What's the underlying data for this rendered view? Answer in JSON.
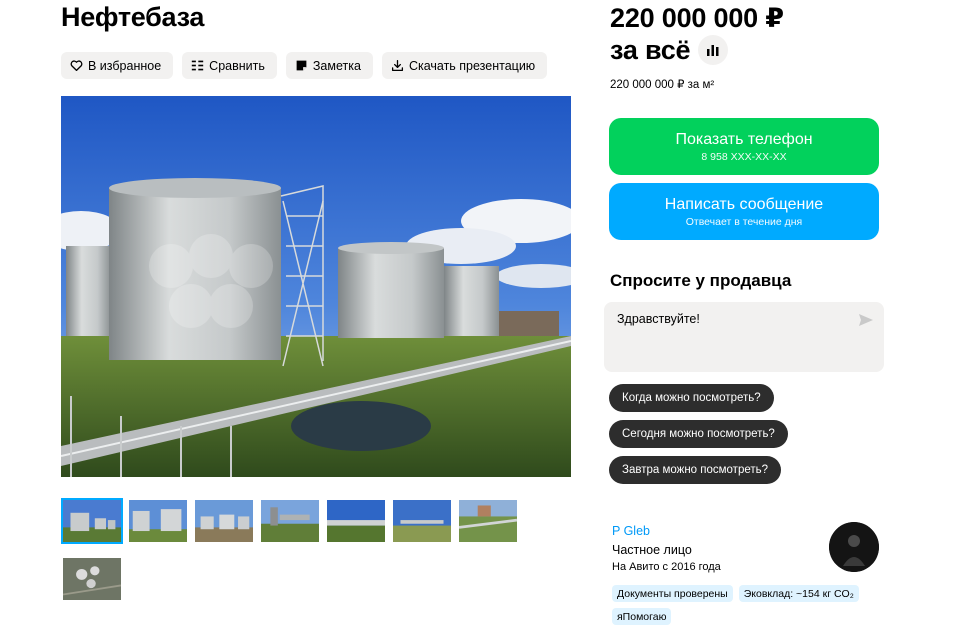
{
  "listing": {
    "title": "Нефтебаза",
    "actions": {
      "favorite": "В избранное",
      "compare": "Сравнить",
      "note": "Заметка",
      "download": "Скачать презентацию"
    },
    "price_line1": "220 000 000 ₽",
    "price_line2": "за всё",
    "price_per": "220 000 000 ₽ за м²"
  },
  "contact": {
    "phone_label": "Показать телефон",
    "phone_masked": "8 958 XXX-XX-XX",
    "message_label": "Написать сообщение",
    "message_sub": "Отвечает в течение дня"
  },
  "ask": {
    "title": "Спросите у продавца",
    "input_value": "Здравствуйте!",
    "quick_questions": [
      "Когда можно посмотреть?",
      "Сегодня можно посмотреть?",
      "Завтра можно посмотреть?"
    ]
  },
  "seller": {
    "name": "P Gleb",
    "type": "Частное лицо",
    "since": "На Авито с 2016 года",
    "badges": [
      "Документы проверены",
      "Эковклад: ~154 кг CO₂",
      "яПомогаю"
    ]
  },
  "colors": {
    "phone_button": "#02d15c",
    "message_button": "#00aaff",
    "chip_bg": "#2d2d2d",
    "seller_link": "#0099f7",
    "badge_bg": "#dff3ff"
  },
  "icons": {
    "favorite": "heart-icon",
    "compare": "compare-icon",
    "note": "note-icon",
    "download": "download-icon",
    "stats": "bar-chart-icon",
    "send": "send-icon"
  }
}
